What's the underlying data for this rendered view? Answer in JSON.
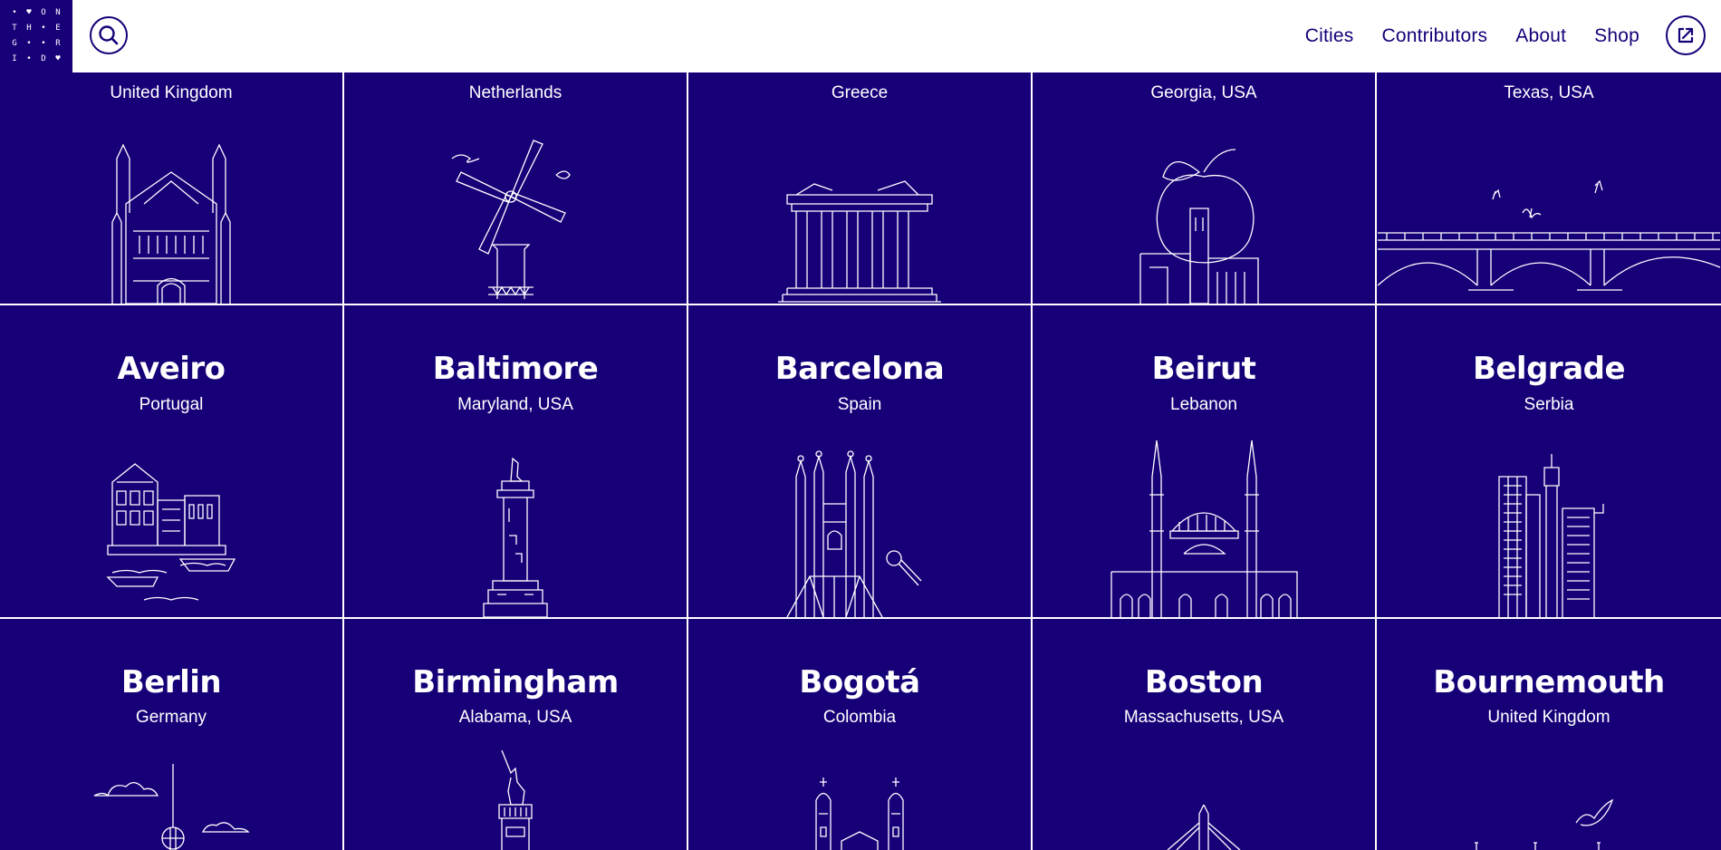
{
  "header": {
    "logo_chars": [
      "•",
      "♥",
      "O",
      "N",
      "T",
      "H",
      "•",
      "E",
      "G",
      "•",
      "•",
      "R",
      "I",
      "•",
      "D",
      "♥"
    ],
    "nav": [
      {
        "label": "Cities"
      },
      {
        "label": "Contributors"
      },
      {
        "label": "About"
      },
      {
        "label": "Shop"
      }
    ]
  },
  "rows": [
    {
      "cities": [
        {
          "city": "",
          "country": "United Kingdom",
          "icon": "gothic-building-icon"
        },
        {
          "city": "",
          "country": "Netherlands",
          "icon": "windmill-icon"
        },
        {
          "city": "",
          "country": "Greece",
          "icon": "parthenon-icon"
        },
        {
          "city": "",
          "country": "Georgia, USA",
          "icon": "peach-tower-icon"
        },
        {
          "city": "",
          "country": "Texas, USA",
          "icon": "bridge-bats-icon"
        }
      ]
    },
    {
      "cities": [
        {
          "city": "Aveiro",
          "country": "Portugal",
          "icon": "houses-boats-icon"
        },
        {
          "city": "Baltimore",
          "country": "Maryland, USA",
          "icon": "monument-column-icon"
        },
        {
          "city": "Barcelona",
          "country": "Spain",
          "icon": "sagrada-familia-icon"
        },
        {
          "city": "Beirut",
          "country": "Lebanon",
          "icon": "mosque-icon"
        },
        {
          "city": "Belgrade",
          "country": "Serbia",
          "icon": "skyscraper-tower-icon"
        }
      ]
    },
    {
      "cities": [
        {
          "city": "Berlin",
          "country": "Germany",
          "icon": "tv-tower-icon"
        },
        {
          "city": "Birmingham",
          "country": "Alabama, USA",
          "icon": "vulcan-statue-icon"
        },
        {
          "city": "Bogotá",
          "country": "Colombia",
          "icon": "cathedral-icon"
        },
        {
          "city": "Boston",
          "country": "Massachusetts, USA",
          "icon": "zakim-bridge-icon"
        },
        {
          "city": "Bournemouth",
          "country": "United Kingdom",
          "icon": "seagull-pier-icon"
        }
      ]
    }
  ],
  "colors": {
    "background": "#160078",
    "header": "#ffffff",
    "text": "#ffffff",
    "nav_text": "#160078"
  }
}
